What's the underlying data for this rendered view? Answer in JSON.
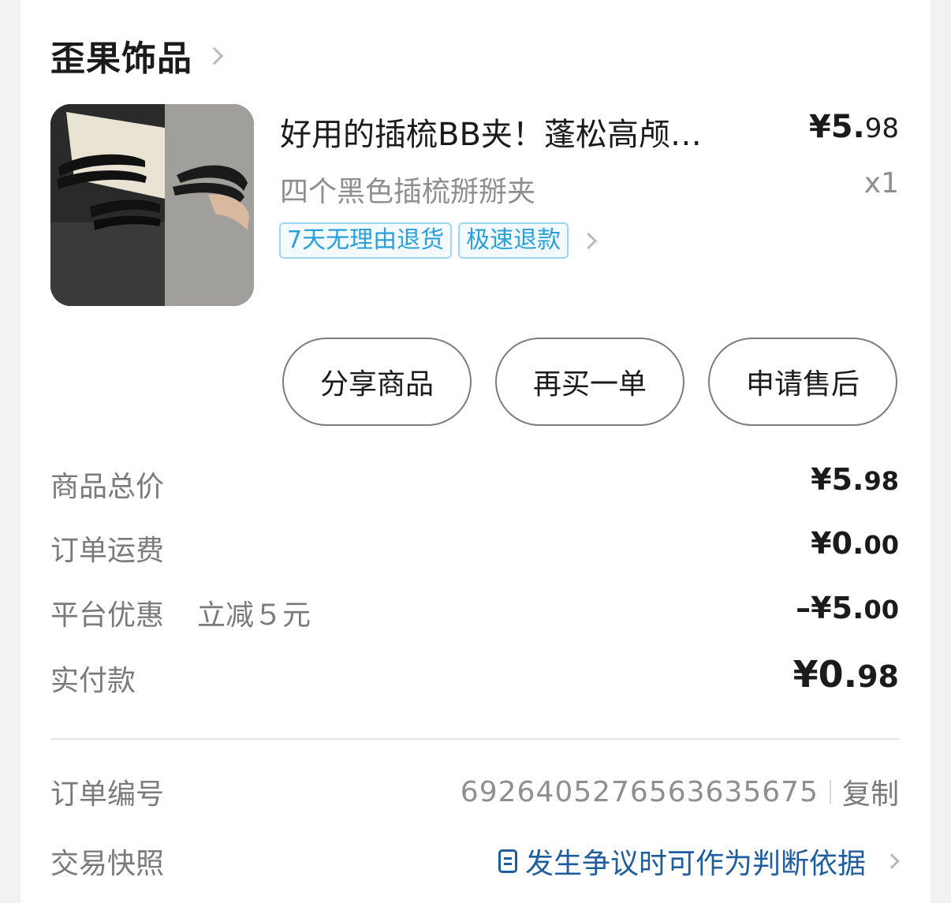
{
  "shop": {
    "name": "歪果饰品"
  },
  "product": {
    "title": "好用的插梳BB夹！蓬松高颅…",
    "price_main": "¥5.",
    "price_dec": "98",
    "spec": "四个黑色插梳掰掰夹",
    "qty": "x1",
    "tags": [
      "7天无理由退货",
      "极速退款"
    ]
  },
  "actions": {
    "share": "分享商品",
    "rebuy": "再买一单",
    "after_sale": "申请售后"
  },
  "summary": {
    "goods_total_label": "商品总价",
    "goods_total_main": "¥5.",
    "goods_total_dec": "98",
    "shipping_label": "订单运费",
    "shipping_main": "¥0.",
    "shipping_dec": "00",
    "discount_label": "平台优惠",
    "discount_note": "立减５元",
    "discount_main": "–¥5.",
    "discount_dec": "00",
    "paid_label": "实付款",
    "paid_main": "¥0.",
    "paid_dec": "98"
  },
  "order": {
    "number_label": "订单编号",
    "number": "6926405276563635675",
    "copy_label": "复制",
    "snapshot_label": "交易快照",
    "snapshot_link": "发生争议时可作为判断依据"
  },
  "colors": {
    "tag_blue": "#2aa0d8",
    "link_blue": "#1f5d9c",
    "muted": "#8e8e93"
  },
  "icons": [
    "chevron-right-icon",
    "document-icon"
  ]
}
